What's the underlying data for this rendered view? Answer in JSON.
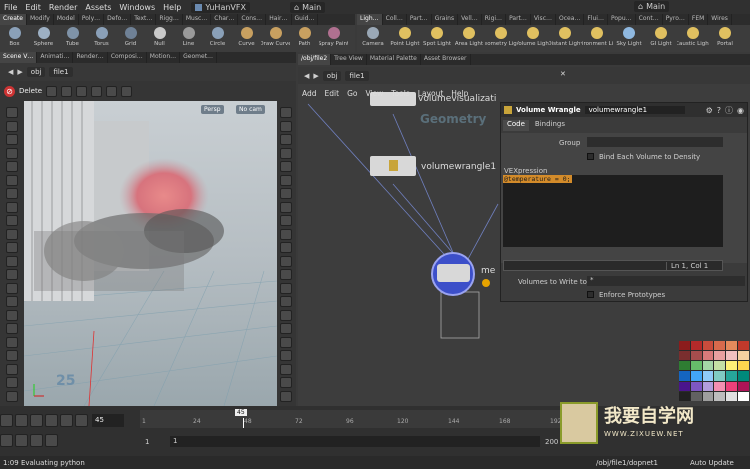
{
  "menubar": {
    "items": [
      "File",
      "Edit",
      "Render",
      "Assets",
      "Windows",
      "Help"
    ],
    "desktop": "YuHanVFX",
    "workspace": "Main",
    "workspace_right": "Main"
  },
  "shelf_left": {
    "tabs": [
      "Create",
      "Modify",
      "Model",
      "Poly…",
      "Defo…",
      "Text…",
      "Rigg…",
      "Musc…",
      "Char…",
      "Cons…",
      "Hair…",
      "Guid…"
    ],
    "tools": [
      {
        "label": "Box",
        "color": "#8aa0b8"
      },
      {
        "label": "Sphere",
        "color": "#9db0c4"
      },
      {
        "label": "Tube",
        "color": "#7f93a8"
      },
      {
        "label": "Torus",
        "color": "#8aa0b8"
      },
      {
        "label": "Grid",
        "color": "#6f8196"
      },
      {
        "label": "Null",
        "color": "#c9c9c9"
      },
      {
        "label": "Line",
        "color": "#9a9a9a"
      },
      {
        "label": "Circle",
        "color": "#8aa0b8"
      },
      {
        "label": "Curve",
        "color": "#c8a060"
      },
      {
        "label": "Draw Curve",
        "color": "#c8a060"
      },
      {
        "label": "Path",
        "color": "#c8a060"
      },
      {
        "label": "Spray Paint",
        "color": "#b07090"
      }
    ]
  },
  "shelf_right": {
    "tabs": [
      "Ligh…",
      "Coll…",
      "Part…",
      "Grains",
      "Vell…",
      "Rigi…",
      "Part…",
      "Visc…",
      "Ocea…",
      "Flui…",
      "Popu…",
      "Cont…",
      "Pyro…",
      "FEM",
      "Wires"
    ],
    "tools": [
      {
        "label": "Camera",
        "color": "#9aa8b6"
      },
      {
        "label": "Point Light",
        "color": "#e0c060"
      },
      {
        "label": "Spot Light",
        "color": "#e0c060"
      },
      {
        "label": "Area Light",
        "color": "#e0c060"
      },
      {
        "label": "Geometry Light",
        "color": "#e0c060"
      },
      {
        "label": "Volume Light",
        "color": "#e0c060"
      },
      {
        "label": "Distant Light",
        "color": "#e0c060"
      },
      {
        "label": "Environment Light",
        "color": "#e0c060"
      },
      {
        "label": "Sky Light",
        "color": "#8fb8e0"
      },
      {
        "label": "GI Light",
        "color": "#e0c060"
      },
      {
        "label": "Caustic Light",
        "color": "#e0c060"
      },
      {
        "label": "Portal",
        "color": "#e0c060"
      }
    ]
  },
  "left_pane": {
    "tabs": [
      "Scene V…",
      "Animati…",
      "Render…",
      "Composi…",
      "Motion…",
      "Geomet…"
    ],
    "path_obj": "obj",
    "path_node": "file1",
    "delete_label": "Delete",
    "persp_label": "Persp",
    "cam_label": "No cam",
    "frame_number": "25"
  },
  "right_pane": {
    "tabs": [
      "/obj/file2",
      "Tree View",
      "Material Palette",
      "Asset Browser"
    ],
    "path_obj": "obj",
    "path_node": "file1",
    "net_menu": [
      "Add",
      "Edit",
      "Go",
      "View",
      "Tools",
      "Layout",
      "Help"
    ],
    "geometry_watermark": "Geometry",
    "node_top_label": "volumevisualizati",
    "node_wrangle_label": "volumewrangle1",
    "node_merge_label": "me"
  },
  "param_window": {
    "node_type": "Volume Wrangle",
    "node_name": "volumewrangle1",
    "tabs": [
      "Code",
      "Bindings"
    ],
    "group_label": "Group",
    "bind_each_label": "Bind Each Volume to Density",
    "vex_label": "VEXpression",
    "vex_code": "@temperature = 0;",
    "cursor_pos": "Ln 1, Col 1",
    "volumes_label": "Volumes to Write to",
    "volumes_value": "*",
    "enforce_label": "Enforce Prototypes"
  },
  "timeline": {
    "current_frame": "45",
    "frame_marker": "45",
    "ticks": [
      "1",
      "24",
      "48",
      "72",
      "96",
      "120",
      "144",
      "168",
      "192"
    ],
    "start_a": "1",
    "start_b": "1",
    "end": "200"
  },
  "status": {
    "message": "1:09 Evaluating python",
    "path": "/obj/file1/dopnet1",
    "auto_update": "Auto Update"
  },
  "watermark": {
    "text_cn": "我要自学网",
    "url": "WWW.ZIXUEW.NET"
  },
  "palette": [
    "#8b1c1c",
    "#b52a2a",
    "#c94c3c",
    "#d86a4c",
    "#e58a5c",
    "#c0392b",
    "#7a2e2e",
    "#a64d4d",
    "#d97a7a",
    "#e8a0a0",
    "#f0c0c0",
    "#f5d0a0",
    "#2e7d32",
    "#66bb6a",
    "#a5d6a7",
    "#c5e1a5",
    "#fff176",
    "#ffd54f",
    "#1565c0",
    "#42a5f5",
    "#90caf9",
    "#80cbc4",
    "#26a69a",
    "#00897b",
    "#4a148c",
    "#7e57c2",
    "#b39ddb",
    "#f48fb1",
    "#ec407a",
    "#ad1457",
    "#212121",
    "#616161",
    "#9e9e9e",
    "#bdbdbd",
    "#e0e0e0",
    "#ffffff"
  ]
}
